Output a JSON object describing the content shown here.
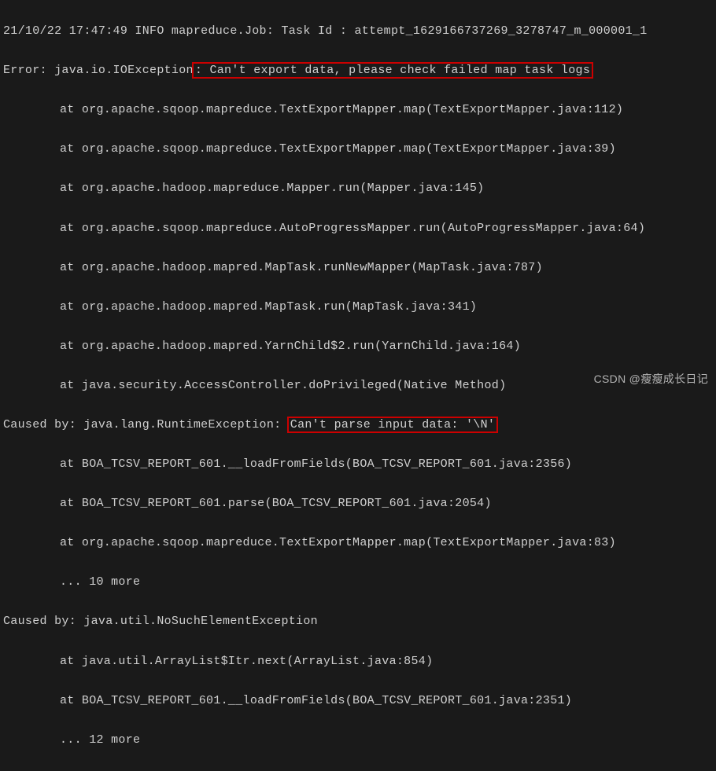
{
  "log": {
    "line1": "21/10/22 17:47:49 INFO mapreduce.Job: Task Id : attempt_1629166737269_3278747_m_000001_1",
    "error_prefix": "Error: java.io.IOException",
    "error_highlight": ": Can't export data, please check failed map task logs",
    "stack1": "at org.apache.sqoop.mapreduce.TextExportMapper.map(TextExportMapper.java:112)",
    "stack2": "at org.apache.sqoop.mapreduce.TextExportMapper.map(TextExportMapper.java:39)",
    "stack3": "at org.apache.hadoop.mapreduce.Mapper.run(Mapper.java:145)",
    "stack4": "at org.apache.sqoop.mapreduce.AutoProgressMapper.run(AutoProgressMapper.java:64)",
    "stack5": "at org.apache.hadoop.mapred.MapTask.runNewMapper(MapTask.java:787)",
    "stack6": "at org.apache.hadoop.mapred.MapTask.run(MapTask.java:341)",
    "stack7": "at org.apache.hadoop.mapred.YarnChild$2.run(YarnChild.java:164)",
    "stack8": "at java.security.AccessController.doPrivileged(Native Method)",
    "caused1_prefix": "Caused by: java.lang.RuntimeException: ",
    "caused1_highlight": "Can't parse input data: '\\N'",
    "stack9": "at BOA_TCSV_REPORT_601.__loadFromFields(BOA_TCSV_REPORT_601.java:2356)",
    "stack10": "at BOA_TCSV_REPORT_601.parse(BOA_TCSV_REPORT_601.java:2054)",
    "stack11": "at org.apache.sqoop.mapreduce.TextExportMapper.map(TextExportMapper.java:83)",
    "more1": "... 10 more",
    "caused2": "Caused by: java.util.NoSuchElementException",
    "stack12": "at java.util.ArrayList$Itr.next(ArrayList.java:854)",
    "stack13": "at BOA_TCSV_REPORT_601.__loadFromFields(BOA_TCSV_REPORT_601.java:2351)",
    "more2": "... 12 more"
  },
  "watermark": "CSDN @瘦瘦成长日记"
}
